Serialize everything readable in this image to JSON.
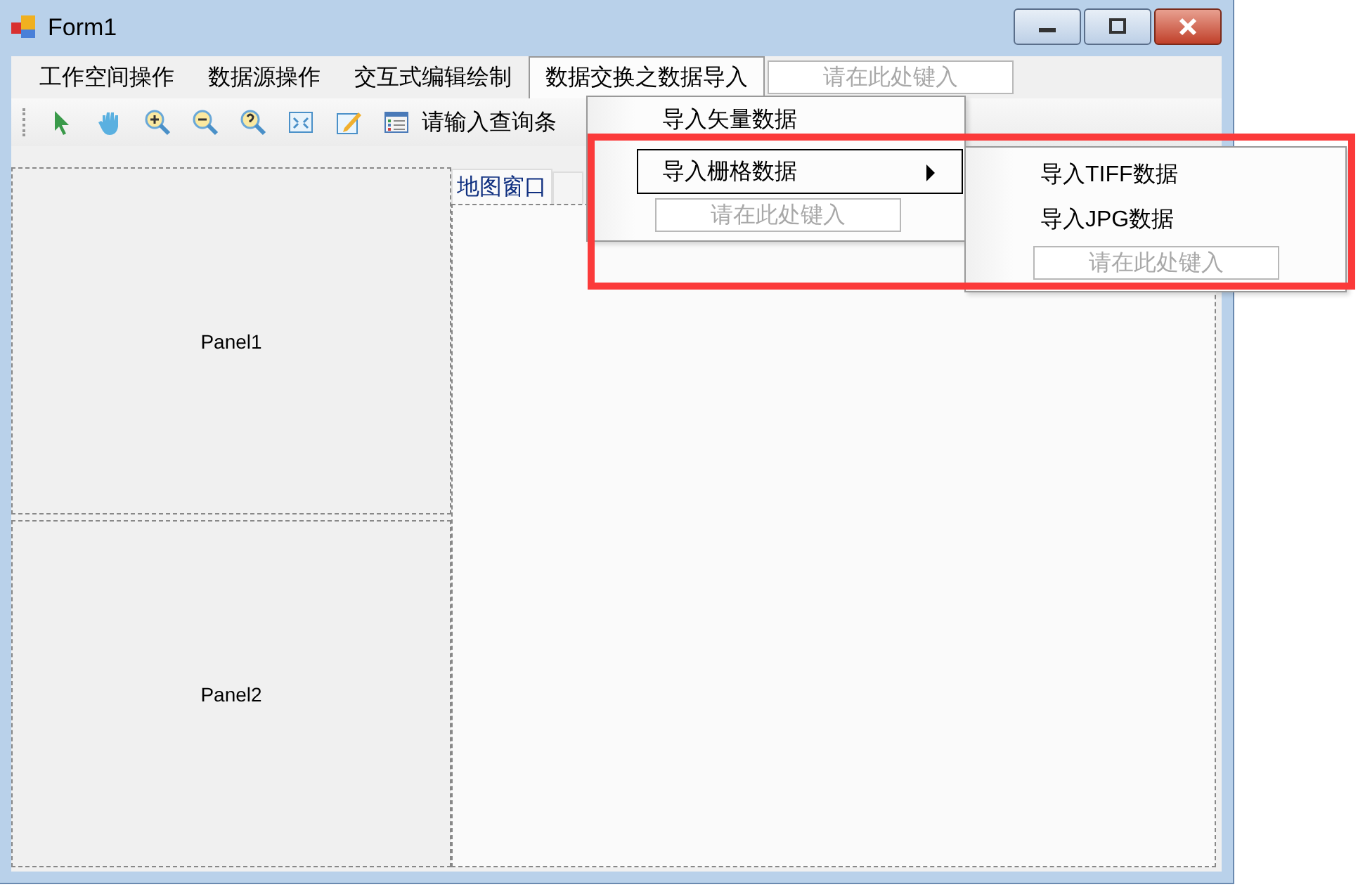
{
  "window": {
    "title": "Form1"
  },
  "menu_bar": {
    "items": [
      {
        "label": "工作空间操作",
        "open": false
      },
      {
        "label": "数据源操作",
        "open": false
      },
      {
        "label": "交互式编辑绘制",
        "open": false
      },
      {
        "label": "数据交换之数据导入",
        "open": true
      }
    ],
    "placeholder": "请在此处键入"
  },
  "toolbar": {
    "label": "请输入查询条"
  },
  "panels": [
    {
      "label": "Panel1"
    },
    {
      "label": "Panel2"
    }
  ],
  "tabs": [
    {
      "label": "地图窗口",
      "selected": true
    }
  ],
  "dropdown": {
    "items": [
      {
        "label": "导入矢量数据",
        "highlighted": false,
        "has_submenu": false
      },
      {
        "label": "导入栅格数据",
        "highlighted": true,
        "has_submenu": true
      }
    ],
    "placeholder": "请在此处键入"
  },
  "submenu": {
    "items": [
      {
        "label": "导入TIFF数据",
        "highlighted": false
      },
      {
        "label": "导入JPG数据",
        "highlighted": false
      }
    ],
    "placeholder": "请在此处键入"
  }
}
